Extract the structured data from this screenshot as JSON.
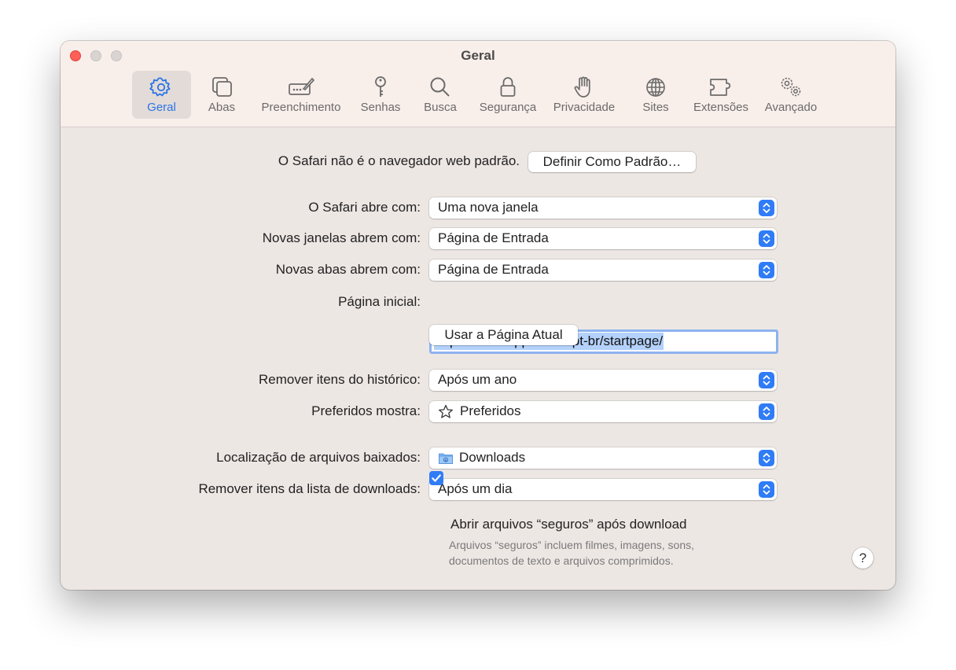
{
  "window": {
    "title": "Geral",
    "accent": "#2f7cf6"
  },
  "toolbar": {
    "tabs": [
      {
        "label": "Geral",
        "icon": "gear-icon",
        "active": true
      },
      {
        "label": "Abas",
        "icon": "tabs-icon"
      },
      {
        "label": "Preenchimento",
        "icon": "autofill-icon"
      },
      {
        "label": "Senhas",
        "icon": "key-icon"
      },
      {
        "label": "Busca",
        "icon": "search-icon"
      },
      {
        "label": "Segurança",
        "icon": "lock-icon"
      },
      {
        "label": "Privacidade",
        "icon": "hand-icon"
      },
      {
        "label": "Sites",
        "icon": "globe-icon"
      },
      {
        "label": "Extensões",
        "icon": "puzzle-icon"
      },
      {
        "label": "Avançado",
        "icon": "gears-icon"
      }
    ]
  },
  "default_browser": {
    "text": "O Safari não é o navegador web padrão.",
    "button": "Definir Como Padrão…"
  },
  "settings": {
    "opens_with": {
      "label": "O Safari abre com:",
      "value": "Uma nova janela"
    },
    "new_windows": {
      "label": "Novas janelas abrem com:",
      "value": "Página de Entrada"
    },
    "new_tabs": {
      "label": "Novas abas abrem com:",
      "value": "Página de Entrada"
    },
    "homepage": {
      "label": "Página inicial:",
      "value": "https://www.apple.com/pt-br/startpage/",
      "button": "Usar a Página Atual"
    },
    "history": {
      "label": "Remover itens do histórico:",
      "value": "Após um ano"
    },
    "favorites": {
      "label": "Preferidos mostra:",
      "value": "Preferidos",
      "icon": "star-icon"
    },
    "download_location": {
      "label": "Localização de arquivos baixados:",
      "value": "Downloads",
      "icon": "folder-icon"
    },
    "download_list": {
      "label": "Remover itens da lista de downloads:",
      "value": "Após um dia"
    },
    "open_safe": {
      "label": "Abrir arquivos “seguros” após download",
      "checked": true,
      "hint_line1": "Arquivos “seguros” incluem filmes, imagens, sons,",
      "hint_line2": "documentos de texto e arquivos comprimidos."
    }
  },
  "help": {
    "label": "?"
  }
}
